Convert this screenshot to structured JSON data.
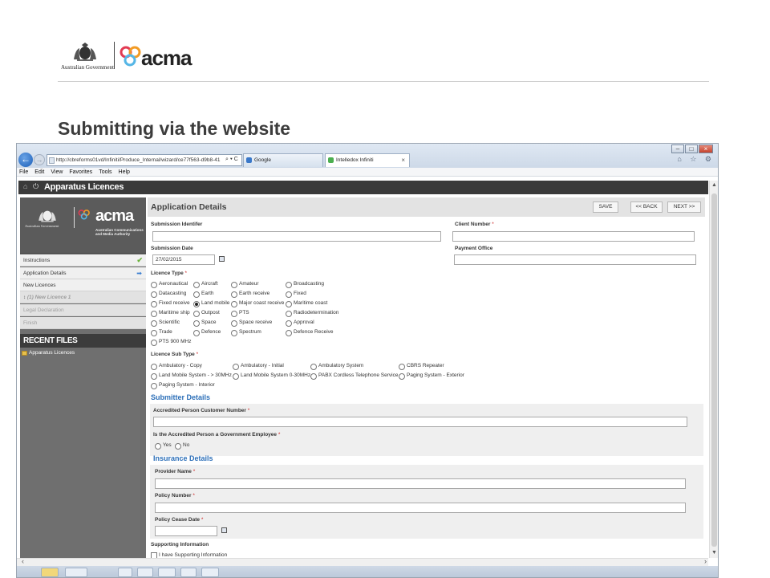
{
  "slide": {
    "title": "Submitting via the website",
    "gov_text": "Australian Government",
    "logo_word": "acma"
  },
  "browser": {
    "address": "http://cbreforms01vd/Infiniti/Produce_Internal/wizard/ce77f563-d9b8-41",
    "address_tools": "⌕ ▾ C",
    "tabs": [
      {
        "label": "Google",
        "active": false
      },
      {
        "label": "Intelledox Infiniti",
        "active": true,
        "close": "×"
      }
    ],
    "toolbar_icons": "⌂ ☆ ⚙",
    "window_buttons": {
      "minimize": "–",
      "maximize": "□",
      "close": "×"
    },
    "menu": [
      "File",
      "Edit",
      "View",
      "Favorites",
      "Tools",
      "Help"
    ]
  },
  "app": {
    "title": "Apparatus Licences",
    "home_icon": "⌂",
    "power_icon": "⏻"
  },
  "sidebar": {
    "logo_gov_text": "Australian Government",
    "logo_word": "acma",
    "logo_sub": "Australian Communications and Media Authority",
    "nav": [
      {
        "label": "Instructions",
        "state": "done",
        "marker": "✔"
      },
      {
        "label": "Application Details",
        "state": "current",
        "marker": "➡"
      },
      {
        "label": "New Licences",
        "state": "normal",
        "marker": ""
      },
      {
        "label": "(1) New Licence 1",
        "state": "sub",
        "marker": "↕"
      },
      {
        "label": "Legal Declaration",
        "state": "dim",
        "marker": ""
      },
      {
        "label": "Finish",
        "state": "dim",
        "marker": ""
      }
    ],
    "recent_files_title": "RECENT FILES",
    "recent_files": [
      "Apparatus Licences"
    ]
  },
  "form": {
    "title": "Application Details",
    "buttons": {
      "save": "SAVE",
      "back": "<< BACK",
      "next": "NEXT >>"
    },
    "submission_identifier_label": "Submission Identifer",
    "client_number_label": "Client Number",
    "submission_date_label": "Submission Date",
    "submission_date_value": "27/02/2015",
    "payment_office_label": "Payment Office",
    "required_mark": "*",
    "licence_type_label": "Licence Type",
    "licence_type_selected": "Land mobile",
    "licence_types": [
      [
        "Aeronautical",
        "Aircraft",
        "Amateur",
        "Broadcasting"
      ],
      [
        "Datacasting",
        "Earth",
        "Earth receive",
        "Fixed"
      ],
      [
        "Fixed receive",
        "Land mobile",
        "Major coast receive",
        "Maritime coast"
      ],
      [
        "Maritime ship",
        "Outpost",
        "PTS",
        "Radiodetermination"
      ],
      [
        "Scientific",
        "Space",
        "Space receive",
        "Approval"
      ],
      [
        "Trade",
        "Defence",
        "Spectrum",
        "Defence Receive"
      ],
      [
        "PTS 900 MHz"
      ]
    ],
    "licence_sub_type_label": "Licence Sub Type",
    "licence_sub_types": [
      [
        "Ambulatory - Copy",
        "Ambulatory - Initial",
        "Ambulatory System",
        "CBRS Repeater"
      ],
      [
        "Land Mobile System - > 30MHz",
        "Land Mobile System 0-30MHz",
        "PABX Cordless Telephone Service",
        "Paging System - Exterior"
      ],
      [
        "Paging System - Interior"
      ]
    ],
    "submitter_title": "Submitter Details",
    "accredited_label": "Accredited Person Customer Number",
    "gov_employee_label": "Is the Accredited Person a Government Employee",
    "yes": "Yes",
    "no": "No",
    "insurance_title": "Insurance Details",
    "provider_label": "Provider Name",
    "policy_number_label": "Policy Number",
    "policy_cease_label": "Policy Cease Date",
    "supporting_label": "Supporting Information",
    "supporting_checkbox": "I have Supporting Information"
  },
  "scroll": {
    "up": "▲",
    "down": "▼",
    "left": "‹",
    "right": "›"
  },
  "colors": {
    "accent": "#2c6fb8",
    "required": "#cc2222",
    "check": "#6cb33e",
    "app_bar": "#3a3a3a"
  }
}
